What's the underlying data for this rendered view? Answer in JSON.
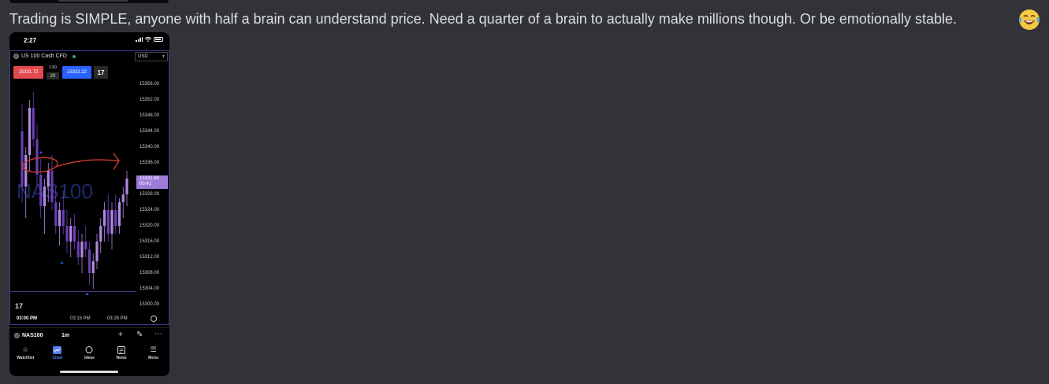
{
  "message": {
    "text": "Trading is SIMPLE, anyone with half a brain can understand price. Need a quarter of a brain to actually make millions though. Or be emotionally stable.",
    "emoji": "joy-emoji"
  },
  "phone": {
    "status_time": "2:27",
    "symbol_title": "US 100 Cash CFD",
    "currency": "USD",
    "sell_price": "15331.72",
    "spread": "1.50",
    "lot": "20",
    "buy_price": "15333.22",
    "tv_logo": "17",
    "price_labels": [
      "15356.00",
      "15352.00",
      "15348.00",
      "15344.00",
      "15340.00",
      "15336.00",
      "15328.00",
      "15324.00",
      "15320.00",
      "15316.00",
      "15312.00",
      "15308.00",
      "15304.00",
      "15300.00"
    ],
    "current_price": "15331.60",
    "countdown": "00:41",
    "time_labels": [
      "03:00 PM",
      "03:15 PM",
      "03:26 PM"
    ],
    "toolbar_symbol": "NAS100",
    "toolbar_interval": "1m",
    "tabs": [
      {
        "label": "Watchlist",
        "icon": "star-icon"
      },
      {
        "label": "Chart",
        "icon": "chart-icon"
      },
      {
        "label": "Ideas",
        "icon": "ideas-icon"
      },
      {
        "label": "News",
        "icon": "news-icon"
      },
      {
        "label": "Menu",
        "icon": "menu-icon"
      }
    ],
    "colors": {
      "sell": "#e24a4f",
      "buy": "#2962ff",
      "candle_up": "#b08be0",
      "candle_down": "#6a3fb5",
      "annotation": "#d13a2f",
      "current_price_bg": "#9c7bd9"
    }
  },
  "chart_data": {
    "type": "candlestick",
    "symbol": "NAS100",
    "interval": "1m",
    "ylim": [
      15298,
      15360
    ],
    "yticks": [
      15356,
      15352,
      15348,
      15344,
      15340,
      15336,
      15328,
      15324,
      15320,
      15316,
      15312,
      15308,
      15304,
      15300
    ],
    "xticks": [
      "03:00 PM",
      "03:15 PM",
      "03:26 PM"
    ],
    "candles": [
      {
        "o": 15344,
        "h": 15351,
        "l": 15326,
        "c": 15330
      },
      {
        "o": 15330,
        "h": 15340,
        "l": 15322,
        "c": 15338
      },
      {
        "o": 15338,
        "h": 15352,
        "l": 15334,
        "c": 15350
      },
      {
        "o": 15350,
        "h": 15354,
        "l": 15340,
        "c": 15342
      },
      {
        "o": 15342,
        "h": 15346,
        "l": 15330,
        "c": 15333
      },
      {
        "o": 15333,
        "h": 15337,
        "l": 15322,
        "c": 15325
      },
      {
        "o": 15325,
        "h": 15332,
        "l": 15318,
        "c": 15330
      },
      {
        "o": 15330,
        "h": 15336,
        "l": 15326,
        "c": 15334
      },
      {
        "o": 15334,
        "h": 15338,
        "l": 15324,
        "c": 15326
      },
      {
        "o": 15326,
        "h": 15330,
        "l": 15318,
        "c": 15320
      },
      {
        "o": 15320,
        "h": 15326,
        "l": 15315,
        "c": 15324
      },
      {
        "o": 15324,
        "h": 15329,
        "l": 15318,
        "c": 15320
      },
      {
        "o": 15320,
        "h": 15324,
        "l": 15313,
        "c": 15316
      },
      {
        "o": 15316,
        "h": 15322,
        "l": 15312,
        "c": 15320
      },
      {
        "o": 15320,
        "h": 15323,
        "l": 15314,
        "c": 15316
      },
      {
        "o": 15316,
        "h": 15319,
        "l": 15310,
        "c": 15312
      },
      {
        "o": 15312,
        "h": 15318,
        "l": 15308,
        "c": 15316
      },
      {
        "o": 15316,
        "h": 15320,
        "l": 15312,
        "c": 15314
      },
      {
        "o": 15314,
        "h": 15316,
        "l": 15305,
        "c": 15308
      },
      {
        "o": 15308,
        "h": 15313,
        "l": 15304,
        "c": 15311
      },
      {
        "o": 15311,
        "h": 15318,
        "l": 15309,
        "c": 15316
      },
      {
        "o": 15316,
        "h": 15322,
        "l": 15313,
        "c": 15320
      },
      {
        "o": 15320,
        "h": 15326,
        "l": 15316,
        "c": 15324
      },
      {
        "o": 15324,
        "h": 15328,
        "l": 15316,
        "c": 15318
      },
      {
        "o": 15318,
        "h": 15326,
        "l": 15314,
        "c": 15324
      },
      {
        "o": 15324,
        "h": 15328,
        "l": 15318,
        "c": 15320
      },
      {
        "o": 15320,
        "h": 15327,
        "l": 15318,
        "c": 15326
      },
      {
        "o": 15326,
        "h": 15330,
        "l": 15322,
        "c": 15328
      },
      {
        "o": 15328,
        "h": 15334,
        "l": 15325,
        "c": 15332
      }
    ],
    "current_price": 15331.6
  }
}
